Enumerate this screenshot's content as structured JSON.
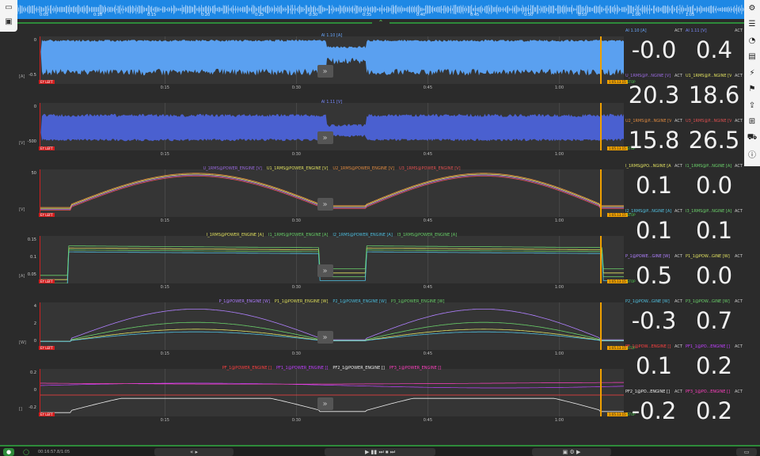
{
  "overview": {
    "ticks": [
      "0:05",
      "0:10",
      "0:15",
      "0:20",
      "0:25",
      "0:30",
      "0:35",
      "0:40",
      "0:45",
      "0:50",
      "0:55",
      "1:00",
      "1:05"
    ]
  },
  "panels": [
    {
      "title": [
        {
          "text": "AI 1.10 [A]",
          "color": "#6aa8ff"
        }
      ],
      "y_labels": [
        "0",
        "-0.5"
      ],
      "unit": "[A]",
      "x_labels": [
        "0:15",
        "0:30",
        "0:45",
        "1:00"
      ],
      "tag_left": "EY LEFT",
      "tag_right": "1:05.13.15",
      "tag_stop": "STOP"
    },
    {
      "title": [
        {
          "text": "AI 1.11 [V]",
          "color": "#7c8cff"
        }
      ],
      "y_labels": [
        "0",
        "-500"
      ],
      "unit": "[V]",
      "x_labels": [
        "0:15",
        "0:30",
        "0:45",
        "1:00"
      ],
      "tag_left": "EY LEFT",
      "tag_right": "1:05.13.15",
      "tag_stop": "STOP"
    },
    {
      "title": [
        {
          "text": "U_1RMS@POWER_ENGINE [V]",
          "color": "#9a6adf"
        },
        {
          "text": "U1_1RMS@POWER_ENGINE [V]",
          "color": "#e0e060"
        },
        {
          "text": "U2_1RMS@POWER_ENGINE [V]",
          "color": "#e08a40"
        },
        {
          "text": "U3_1RMS@POWER_ENGINE [V]",
          "color": "#e05050"
        }
      ],
      "y_labels": [
        "50"
      ],
      "unit": "[V]",
      "x_labels": [
        "0:15",
        "0:30",
        "0:45",
        "1:00"
      ],
      "tag_left": "EY LEFT",
      "tag_right": "1:05.13.15",
      "tag_stop": "STOP"
    },
    {
      "title": [
        {
          "text": "I_1RMS@POWER_ENGINE [A]",
          "color": "#e0e060"
        },
        {
          "text": "I1_1RMS@POWER_ENGINE [A]",
          "color": "#6ad06a"
        },
        {
          "text": "I2_1RMS@POWER_ENGINE [A]",
          "color": "#50c0e0"
        },
        {
          "text": "I3_1RMS@POWER_ENGINE [A]",
          "color": "#6ad06a"
        }
      ],
      "y_labels": [
        "0.15",
        "0.1",
        "0.05"
      ],
      "unit": "[A]",
      "x_labels": [
        "0:15",
        "0:30",
        "0:45",
        "1:00"
      ],
      "tag_left": "EY LEFT",
      "tag_right": "1:05.13.15",
      "tag_stop": "STOP"
    },
    {
      "title": [
        {
          "text": "P_1@POWER_ENGINE [W]",
          "color": "#b080ff"
        },
        {
          "text": "P1_1@POWER_ENGINE [W]",
          "color": "#e0e060"
        },
        {
          "text": "P2_1@POWER_ENGINE [W]",
          "color": "#50c0e0"
        },
        {
          "text": "P3_1@POWER_ENGINE [W]",
          "color": "#6ad06a"
        }
      ],
      "y_labels": [
        "4",
        "2",
        "0"
      ],
      "unit": "[W]",
      "x_labels": [
        "0:15",
        "0:30",
        "0:45",
        "1:00"
      ],
      "tag_left": "EY LEFT",
      "tag_right": "1:05.13.15",
      "tag_stop": "STOP"
    },
    {
      "title": [
        {
          "text": "PF_1@POWER_ENGINE []",
          "color": "#ff4040"
        },
        {
          "text": "PF1_1@POWER_ENGINE []",
          "color": "#c040ff"
        },
        {
          "text": "PF2_1@POWER_ENGINE []",
          "color": "#f0f0f0"
        },
        {
          "text": "PF3_1@POWER_ENGINE []",
          "color": "#ff40c0"
        }
      ],
      "y_labels": [
        "0.2",
        "0",
        "-0.2"
      ],
      "unit": "[]",
      "x_labels": [
        "0:15",
        "0:30",
        "0:45",
        "1:00"
      ],
      "tag_left": "EY LEFT",
      "tag_right": "1:05.13.15",
      "tag_stop": "STOP"
    }
  ],
  "values": [
    {
      "name": "AI 1.10 [A]",
      "name_color": "#6aa8ff",
      "act": "ACT",
      "value": "-0.0"
    },
    {
      "name": "AI 1.11 [V]",
      "name_color": "#7c8cff",
      "act": "ACT",
      "value": "0.4"
    },
    {
      "name": "U_1RMS@P...NGINE [V]",
      "name_color": "#9a6adf",
      "act": "ACT",
      "value": "20.3"
    },
    {
      "name": "U1_1RMS@P...NGINE [V]",
      "name_color": "#e0e060",
      "act": "ACT",
      "value": "18.6"
    },
    {
      "name": "U2_1RMS@P...NGINE [V]",
      "name_color": "#e08a40",
      "act": "ACT",
      "value": "15.8"
    },
    {
      "name": "U3_1RMS@P...NGINE [V]",
      "name_color": "#e05050",
      "act": "ACT",
      "value": "26.5"
    },
    {
      "name": "I_1RMS@PO...NGINE [A]",
      "name_color": "#e0e060",
      "act": "ACT",
      "value": "0.1"
    },
    {
      "name": "I1_1RMS@P...NGINE [A]",
      "name_color": "#6ad06a",
      "act": "ACT",
      "value": "0.0"
    },
    {
      "name": "I2_1RMS@P...NGINE [A]",
      "name_color": "#50c0e0",
      "act": "ACT",
      "value": "0.1"
    },
    {
      "name": "I3_1RMS@P...NGINE [A]",
      "name_color": "#6ad06a",
      "act": "ACT",
      "value": "0.1"
    },
    {
      "name": "P_1@POWE...GINE [W]",
      "name_color": "#b080ff",
      "act": "ACT",
      "value": "0.5"
    },
    {
      "name": "P1_1@POW...GINE [W]",
      "name_color": "#e0e060",
      "act": "ACT",
      "value": "0.0"
    },
    {
      "name": "P2_1@POW...GINE [W]",
      "name_color": "#50c0e0",
      "act": "ACT",
      "value": "-0.3"
    },
    {
      "name": "P3_1@POW...GINE [W]",
      "name_color": "#6ad06a",
      "act": "ACT",
      "value": "0.7"
    },
    {
      "name": "PF_1@POW...ENGINE []",
      "name_color": "#ff4040",
      "act": "ACT",
      "value": "0.1"
    },
    {
      "name": "PF1_1@PO...ENGINE []",
      "name_color": "#c040ff",
      "act": "ACT",
      "value": "0.2"
    },
    {
      "name": "PF2_1@PO...ENGINE []",
      "name_color": "#f0f0f0",
      "act": "ACT",
      "value": "-0.2"
    },
    {
      "name": "PF3_1@PO...ENGINE []",
      "name_color": "#ff40c0",
      "act": "ACT",
      "value": "0.2"
    }
  ],
  "bottom": {
    "time": "00:16:57.8/1:05"
  },
  "icons": {
    "left": [
      "monitor-icon",
      "bus-icon"
    ],
    "right": [
      "gear-icon",
      "list-icon",
      "gauge-icon",
      "report-icon",
      "bolt-icon",
      "flag-icon",
      "export-icon",
      "network-icon",
      "car-icon",
      "info-icon"
    ]
  }
}
